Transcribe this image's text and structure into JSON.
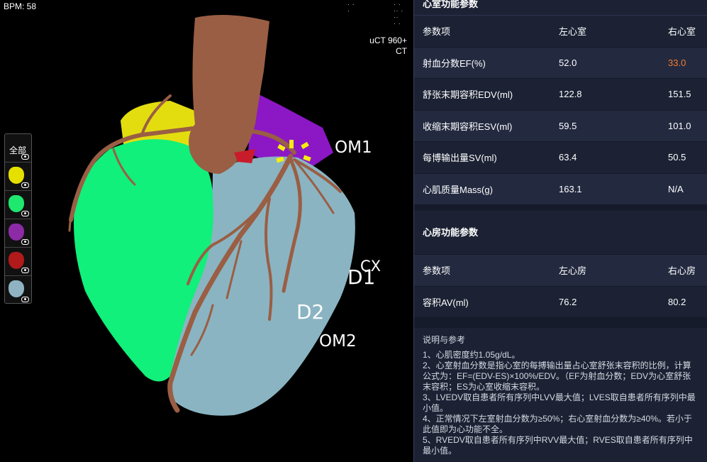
{
  "viewer": {
    "bpm": "BPM: 58",
    "scanner_line1": "uCT 960+",
    "scanner_line2": "CT",
    "labels": {
      "om1": "OM1",
      "cx": "CX",
      "d1": "D1",
      "d2": "D2",
      "om2": "OM2"
    },
    "layers": {
      "all": "全部",
      "items": [
        {
          "name": "layer-yellow",
          "color": "#e6e000"
        },
        {
          "name": "layer-green",
          "color": "#1ee86e"
        },
        {
          "name": "layer-purple",
          "color": "#8d2aa6"
        },
        {
          "name": "layer-red",
          "color": "#b01a1a"
        },
        {
          "name": "layer-blue",
          "color": "#8fb3c2"
        }
      ]
    },
    "colors": {
      "yellow": "#e3dd10",
      "green": "#10f07a",
      "purple": "#8c17c5",
      "blue": "#8ab4c2",
      "artery": "#9a5e44",
      "red": "#c81c2a"
    }
  },
  "ventricle": {
    "title": "心室功能参数",
    "headers": [
      "参数项",
      "左心室",
      "右心室"
    ],
    "rows": [
      {
        "label": "射血分数EF(%)",
        "left": "52.0",
        "right": "33.0"
      },
      {
        "label": "舒张末期容积EDV(ml)",
        "left": "122.8",
        "right": "151.5"
      },
      {
        "label": "收缩末期容积ESV(ml)",
        "left": "59.5",
        "right": "101.0"
      },
      {
        "label": "每博输出量SV(ml)",
        "left": "63.4",
        "right": "50.5"
      },
      {
        "label": "心肌质量Mass(g)",
        "left": "163.1",
        "right": "N/A"
      }
    ],
    "warn_color": "#f47a2b"
  },
  "atrium": {
    "title": "心房功能参数",
    "headers": [
      "参数项",
      "左心房",
      "右心房"
    ],
    "rows": [
      {
        "label": "容积AV(ml)",
        "left": "76.2",
        "right": "80.2"
      }
    ]
  },
  "notes": {
    "title": "说明与参考",
    "lines": [
      "1、心肌密度约1.05g/dL。",
      "2、心室射血分数是指心室的每搏输出量占心室舒张末容积的比例，计算公式为：EF=(EDV-ES)×100%/EDV。（EF为射血分数；EDV为心室舒张末容积；ES为心室收缩末容积。",
      "3、LVEDV取自患者所有序列中LVV最大值；LVES取自患者所有序列中最小值。",
      "4、正常情况下左室射血分数为≥50%；右心室射血分数为≥40%。若小于此值即为心功能不全。",
      "5、RVEDV取自患者所有序列中RVV最大值；RVES取自患者所有序列中最小值。"
    ]
  }
}
